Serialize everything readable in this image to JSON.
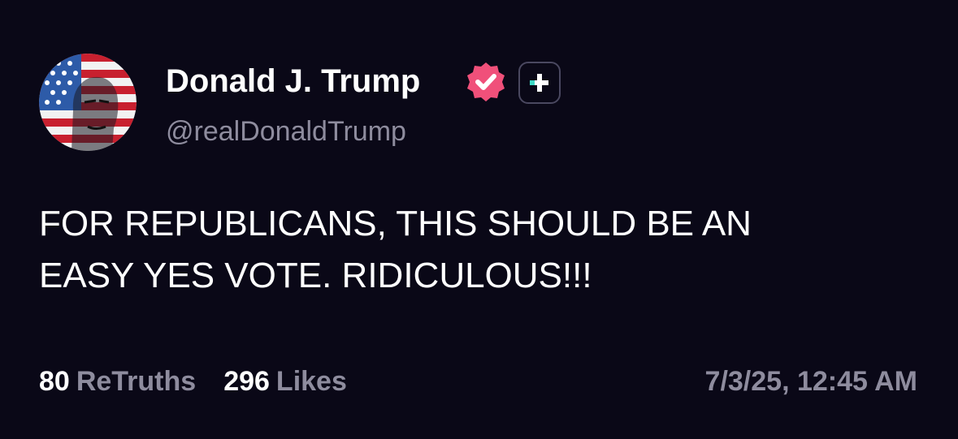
{
  "post": {
    "author": {
      "display_name": "Donald J. Trump",
      "handle": "@realDonaldTrump",
      "avatar_icon": "flag-portrait-avatar",
      "verified_icon": "verified-badge-icon",
      "plus_icon": "plus-badge-icon"
    },
    "text_lines": [
      "FOR REPUBLICANS, THIS SHOULD BE AN",
      "EASY YES VOTE. RIDICULOUS!!!"
    ],
    "stats": {
      "retruths_count": "80",
      "retruths_label": "ReTruths",
      "likes_count": "296",
      "likes_label": "Likes"
    },
    "timestamp": "7/3/25, 12:45 AM"
  },
  "colors": {
    "background": "#0a0817",
    "primary_text": "#ffffff",
    "secondary_text": "#8e8c9e",
    "verified_badge": "#f0507a",
    "plus_accent": "#3fd9c6"
  }
}
